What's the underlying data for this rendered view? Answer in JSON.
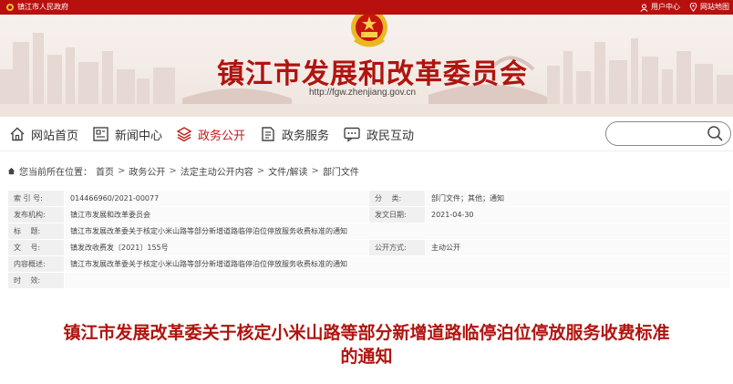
{
  "topbar": {
    "site_name": "镇江市人民政府",
    "user_center": "用户中心",
    "sitemap": "网站地图"
  },
  "header": {
    "title": "镇江市发展和改革委员会",
    "url": "http://fgw.zhenjiang.gov.cn"
  },
  "nav": {
    "items": [
      {
        "label": "网站首页",
        "icon": "home-icon"
      },
      {
        "label": "新闻中心",
        "icon": "newspaper-icon"
      },
      {
        "label": "政务公开",
        "icon": "layers-icon"
      },
      {
        "label": "政务服务",
        "icon": "document-icon"
      },
      {
        "label": "政民互动",
        "icon": "chat-icon"
      }
    ],
    "active": "政务公开"
  },
  "search": {
    "placeholder": ""
  },
  "breadcrumb": {
    "prefix": "您当前所在位置：",
    "items": [
      "首页",
      "政务公开",
      "法定主动公开内容",
      "文件/解读",
      "部门文件"
    ]
  },
  "meta": {
    "index_label": "索 引 号:",
    "index_value": "014466960/2021-00077",
    "category_label": "分　 类:",
    "category_value": "部门文件；其他；通知",
    "publisher_label": "发布机构:",
    "publisher_value": "镇江市发展和改革委员会",
    "date_label": "发文日期:",
    "date_value": "2021-04-30",
    "title_label": "标　 题:",
    "title_value": "镇江市发展改革委关于核定小米山路等部分新增道路临停泊位停放服务收费标准的通知",
    "docno_label": "文　 号:",
    "docno_value": "镇发改收费发〔2021〕155号",
    "openmode_label": "公开方式:",
    "openmode_value": "主动公开",
    "summary_label": "内容概述:",
    "summary_value": "镇江市发展改革委关于核定小米山路等部分新增道路临停泊位停放服务收费标准的通知",
    "validity_label": "时　 效:",
    "validity_value": ""
  },
  "document": {
    "title_line1": "镇江市发展改革委关于核定小米山路等部分新增道路临停泊位停放服务收费标准",
    "title_line2": "的通知"
  },
  "colors": {
    "brand_red": "#b0140f",
    "topbar_red": "#b8100e"
  }
}
